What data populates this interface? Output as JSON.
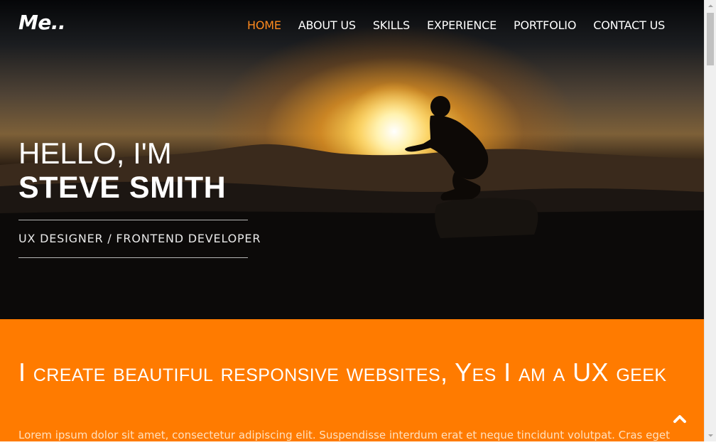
{
  "header": {
    "logo": "Me..",
    "nav": [
      {
        "label": "HOME",
        "active": true
      },
      {
        "label": "ABOUT US",
        "active": false
      },
      {
        "label": "SKILLS",
        "active": false
      },
      {
        "label": "EXPERIENCE",
        "active": false
      },
      {
        "label": "PORTFOLIO",
        "active": false
      },
      {
        "label": "CONTACT US",
        "active": false
      }
    ]
  },
  "hero": {
    "greeting": "HELLO, I'M",
    "name": "STEVE SMITH",
    "role": "UX DESIGNER / FRONTEND DEVELOPER"
  },
  "about": {
    "headline": "I create beautiful responsive websites, Yes I am a UX geek",
    "body": "Lorem ipsum dolor sit amet, consectetur adipiscing elit. Suspendisse interdum erat et neque tincidunt volutpat. Cras eget"
  },
  "colors": {
    "accent": "#ff7b00",
    "nav_active": "#ff8a1e"
  },
  "icons": {
    "back_to_top": "chevron-up-icon"
  }
}
